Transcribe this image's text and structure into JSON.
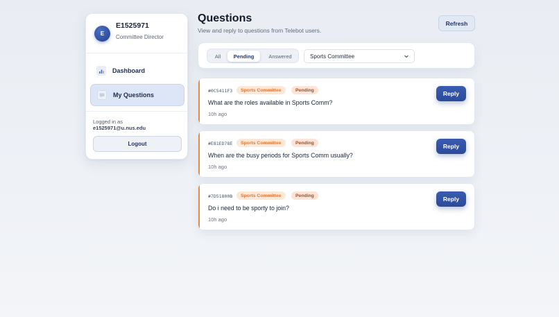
{
  "user": {
    "avatar_initial": "E",
    "id": "E1525971",
    "role": "Committee Director"
  },
  "nav": {
    "items": [
      {
        "label": "Dashboard",
        "icon": "bar-chart-icon"
      },
      {
        "label": "My Questions",
        "icon": "chat-icon",
        "active": true
      }
    ]
  },
  "session": {
    "logged_label": "Logged in as",
    "email": "e1525971@u.nus.edu",
    "logout_label": "Logout"
  },
  "header": {
    "title": "Questions",
    "subtitle": "View and reply to questions from Telebot users.",
    "refresh_label": "Refresh"
  },
  "filters": {
    "tabs": [
      "All",
      "Pending",
      "Answered"
    ],
    "selected_tab": "Pending",
    "committee_select": "Sports Committee"
  },
  "questions": [
    {
      "id": "#0C5411F3",
      "committee": "Sports Committee",
      "status": "Pending",
      "text": "What are the roles available in Sports Comm?",
      "time": "10h ago",
      "reply_label": "Reply"
    },
    {
      "id": "#E81ED78E",
      "committee": "Sports Committee",
      "status": "Pending",
      "text": "When are the busy periods for Sports Comm usually?",
      "time": "10h ago",
      "reply_label": "Reply"
    },
    {
      "id": "#7D51800B",
      "committee": "Sports Committee",
      "status": "Pending",
      "text": "Do i need to be sporty to join?",
      "time": "10h ago",
      "reply_label": "Reply"
    }
  ],
  "colors": {
    "accent": "#2c4a99",
    "pending_border": "#e3894a",
    "committee_tag_bg": "#fde8d8",
    "committee_tag_text": "#e07a32",
    "status_tag_text": "#b04a1a"
  }
}
